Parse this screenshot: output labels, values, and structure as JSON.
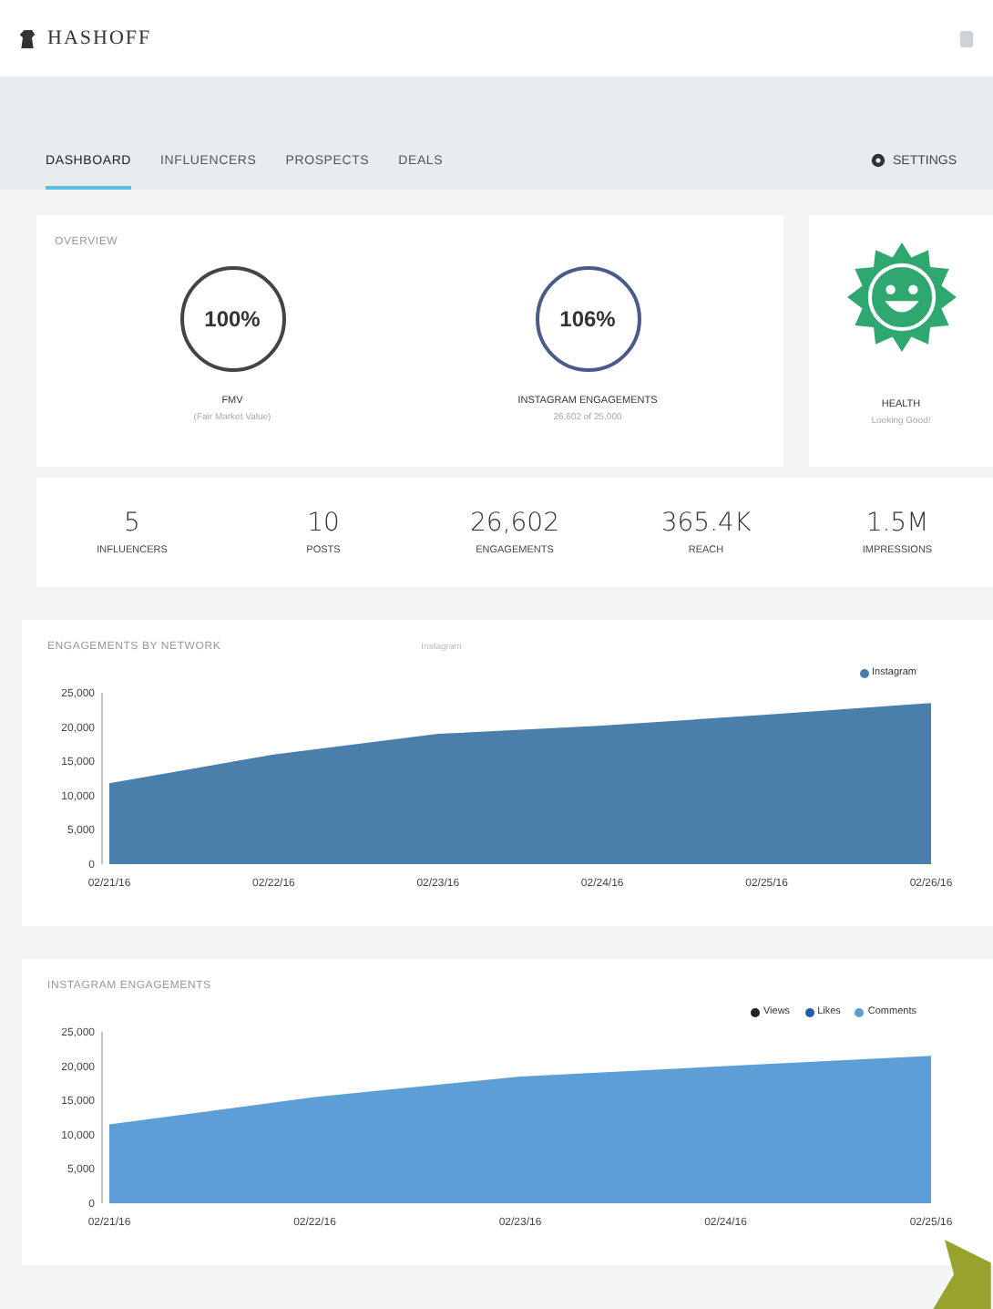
{
  "header": {
    "brand": "HASHOFF"
  },
  "tabs": [
    {
      "label": "DASHBOARD",
      "selected": true
    },
    {
      "label": "INFLUENCERS",
      "selected": false
    },
    {
      "label": "PROSPECTS",
      "selected": false
    },
    {
      "label": "DEALS",
      "selected": false
    }
  ],
  "settings": {
    "label": "SETTINGS"
  },
  "overview": {
    "title": "OVERVIEW",
    "gauges": [
      {
        "value": "100%",
        "label": "FMV",
        "sub": "(Fair Market Value)"
      },
      {
        "value": "106%",
        "label": "INSTAGRAM ENGAGEMENTS",
        "sub": "26,602 of 25,000"
      }
    ]
  },
  "health": {
    "label": "HEALTH",
    "sub": "Looking Good!"
  },
  "stats": [
    {
      "value": "5",
      "label": "INFLUENCERS"
    },
    {
      "value": "10",
      "label": "POSTS"
    },
    {
      "value": "26,602",
      "label": "ENGAGEMENTS"
    },
    {
      "value": "365.4K",
      "label": "REACH"
    },
    {
      "value": "1.5M",
      "label": "IMPRESSIONS"
    }
  ],
  "charts": [
    {
      "title": "ENGAGEMENTS BY NETWORK",
      "note": "Instagram",
      "chart_data": {
        "type": "area",
        "categories": [
          "02/21/16",
          "02/22/16",
          "02/23/16",
          "02/24/16",
          "02/25/16",
          "02/26/16"
        ],
        "ylim": [
          0,
          25000
        ],
        "yticks": [
          0,
          {
            "value": 5000,
            "label": "5,000"
          },
          {
            "value": 10000,
            "label": "10,000"
          },
          {
            "value": 15000,
            "label": "15,000"
          },
          {
            "value": 20000,
            "label": "20,000"
          },
          {
            "value": 25000,
            "label": "25,000"
          }
        ],
        "series": [
          {
            "name": "Instagram",
            "color": "#4a7eab",
            "values": [
              11800,
              16000,
              19000,
              20200,
              21800,
              23500
            ]
          }
        ]
      }
    },
    {
      "title": "INSTAGRAM ENGAGEMENTS",
      "chart_data": {
        "type": "area",
        "categories": [
          "02/21/16",
          "02/22/16",
          "02/23/16",
          "02/24/16",
          "02/25/16"
        ],
        "ylim": [
          0,
          25000
        ],
        "yticks": [
          0,
          {
            "value": 5000,
            "label": "5,000"
          },
          {
            "value": 10000,
            "label": "10,000"
          },
          {
            "value": 15000,
            "label": "15,000"
          },
          {
            "value": 20000,
            "label": "20,000"
          },
          {
            "value": 25000,
            "label": "25,000"
          }
        ],
        "series": [
          {
            "name": "Views",
            "color": "#222222",
            "values": [
              null,
              null,
              null,
              null,
              null
            ]
          },
          {
            "name": "Likes",
            "color": "#1f5fa8",
            "values": [
              null,
              null,
              null,
              null,
              null
            ]
          },
          {
            "name": "Comments",
            "color": "#5b9fd6",
            "values": [
              11500,
              15500,
              18500,
              20000,
              21500
            ]
          }
        ]
      }
    }
  ]
}
